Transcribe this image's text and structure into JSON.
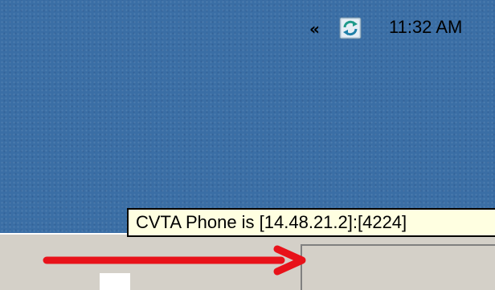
{
  "tooltip": {
    "text": "CVTA Phone is [14.48.21.2]:[4224]"
  },
  "tray": {
    "expand_label": "«",
    "app_icon": "cvta-sync-icon",
    "clock": "11:32 AM"
  },
  "annotation": {
    "arrow_icon": "red-arrow-icon",
    "arrow_color": "#e8121a"
  },
  "colors": {
    "desktop": "#3a6ea5",
    "taskbar": "#d4d0c8",
    "tooltip_bg": "#ffffe1"
  }
}
